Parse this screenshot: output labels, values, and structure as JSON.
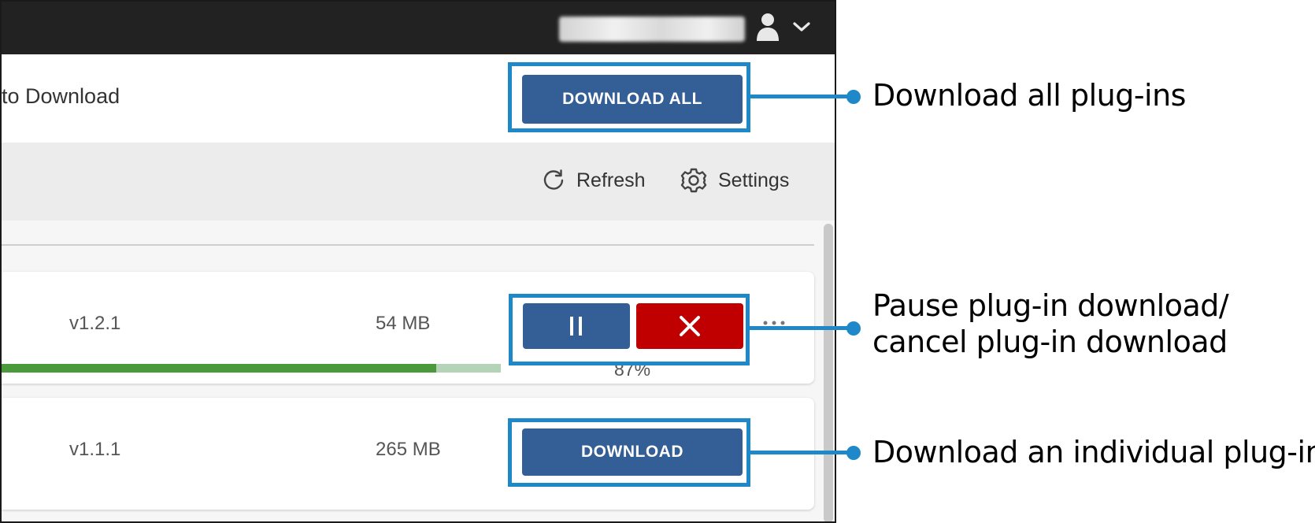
{
  "header": {
    "title": "to Download",
    "download_all_label": "DOWNLOAD ALL"
  },
  "toolbar": {
    "refresh_label": "Refresh",
    "settings_label": "Settings"
  },
  "plugins": [
    {
      "version": "v1.2.1",
      "size": "54 MB",
      "status": "downloading",
      "progress_percent": 87,
      "progress_label": "87%"
    },
    {
      "version": "v1.1.1",
      "size": "265 MB",
      "status": "not_downloaded",
      "download_label": "DOWNLOAD"
    }
  ],
  "callouts": {
    "download_all": "Download all plug-ins",
    "pause_cancel_line1": "Pause plug-in download/",
    "pause_cancel_line2": "cancel plug-in download",
    "download_individual": "Download an individual plug-in"
  },
  "icons": {
    "user": "user-icon",
    "chevron": "chevron-down-icon",
    "refresh": "refresh-icon",
    "settings": "gear-icon",
    "pause": "pause-icon",
    "cancel": "close-icon",
    "more": "more-icon"
  },
  "colors": {
    "topbar": "#222222",
    "primary_button": "#345e96",
    "cancel_button": "#c00000",
    "progress_fill": "#4a9a3c",
    "progress_track": "#b5d3b6",
    "highlight": "#1e88c8"
  }
}
